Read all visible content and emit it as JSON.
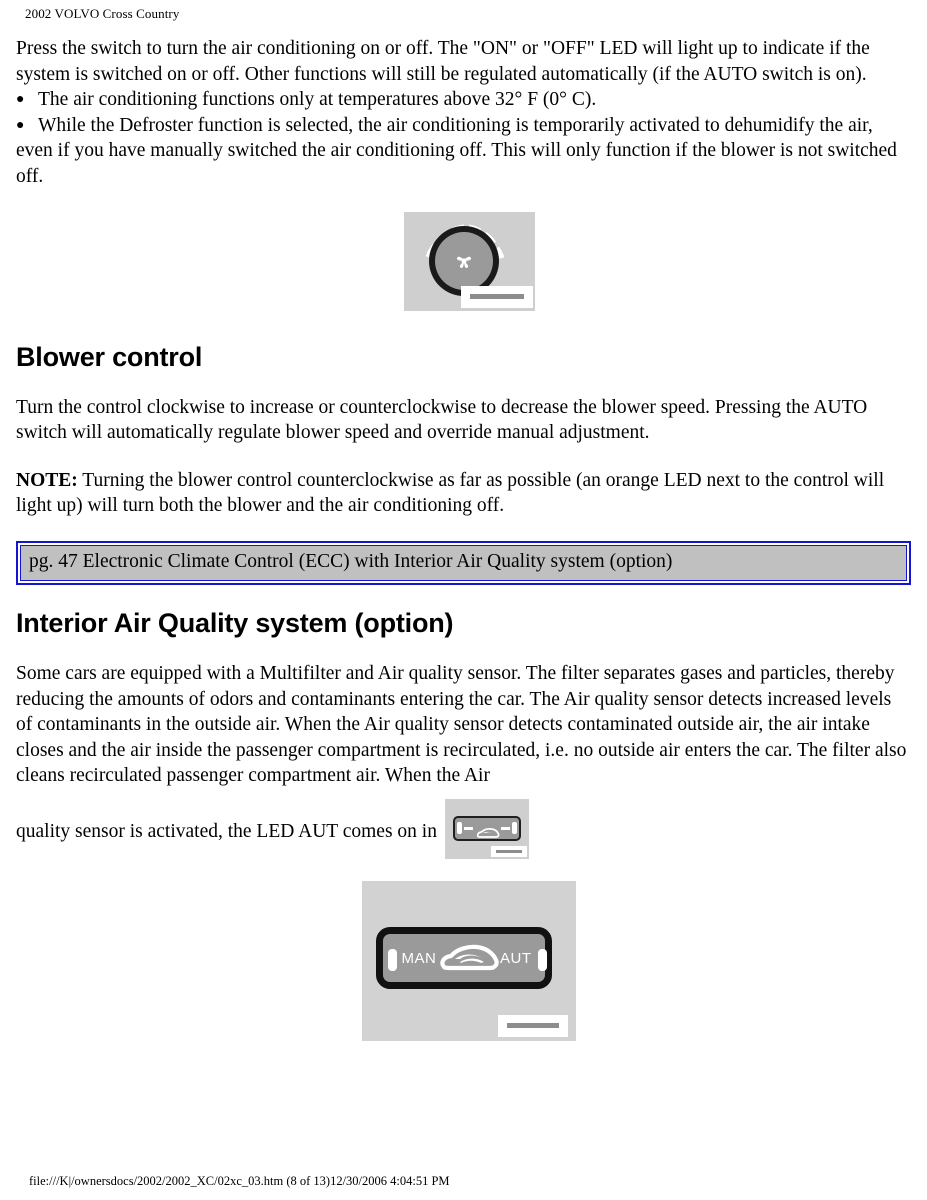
{
  "header": {
    "running_title": "2002 VOLVO Cross Country"
  },
  "content": {
    "intro_paragraph": "Press the switch to turn the air conditioning on or off. The \"ON\" or \"OFF\" LED will light up to indicate if the system is switched on or off. Other functions will still be regulated automatically (if the AUTO switch is on).",
    "bullet_marker": "●",
    "bullets": [
      "The air conditioning functions only at temperatures above 32° F (0° C).",
      "While the Defroster function is selected, the air conditioning is temporarily activated to dehumidify the air, even if you have manually switched the air conditioning off. This will only function if the blower is not switched off."
    ],
    "blower_heading": "Blower control",
    "blower_paragraph": "Turn the control clockwise to increase or counterclockwise to decrease the blower speed. Pressing the AUTO switch will automatically regulate blower speed and override manual adjustment.",
    "note_label": "NOTE:",
    "note_text": " Turning the blower control counterclockwise as far as possible (an orange LED next to the control will light up) will turn both the blower and the air conditioning off.",
    "reference_box": {
      "text": "pg. 47 Electronic Climate Control (ECC) with Interior Air Quality system (option)",
      "border_color": "#1414d2",
      "fill_color": "#c0c0c0"
    },
    "iaq_heading": "Interior Air Quality system (option)",
    "iaq_paragraph": "Some cars are equipped with a Multifilter and Air quality sensor. The filter separates gases and particles, thereby reducing the amounts of odors and contaminants entering the car. The Air quality sensor detects increased levels of contaminants in the outside air. When the Air quality sensor detects contaminated outside air, the air intake closes and the air inside the passenger compartment is recirculated, i.e. no outside air enters the car. The filter also cleans recirculated passenger compartment air. When the Air",
    "iaq_inline_text": "quality sensor is activated, the LED AUT comes on in"
  },
  "figures": {
    "blower_dial": {
      "name": "blower-control-dial",
      "icon": "fan-icon",
      "background_color": "#cfcfcf",
      "dial_ring_color": "#1a1a1a",
      "dial_face_color": "#9a9a9a"
    },
    "aut_button_small": {
      "name": "air-quality-button-small",
      "icon": "car-recirculation-icon",
      "background_color": "#cfcfcf"
    },
    "aut_button_large": {
      "name": "air-quality-button-large",
      "icon": "car-recirculation-icon",
      "background_color": "#d2d2d2",
      "label_left": "MAN",
      "label_right": "AUT"
    }
  },
  "footer": {
    "path_text": "file:///K|/ownersdocs/2002/2002_XC/02xc_03.htm (8 of 13)12/30/2006 4:04:51 PM"
  }
}
